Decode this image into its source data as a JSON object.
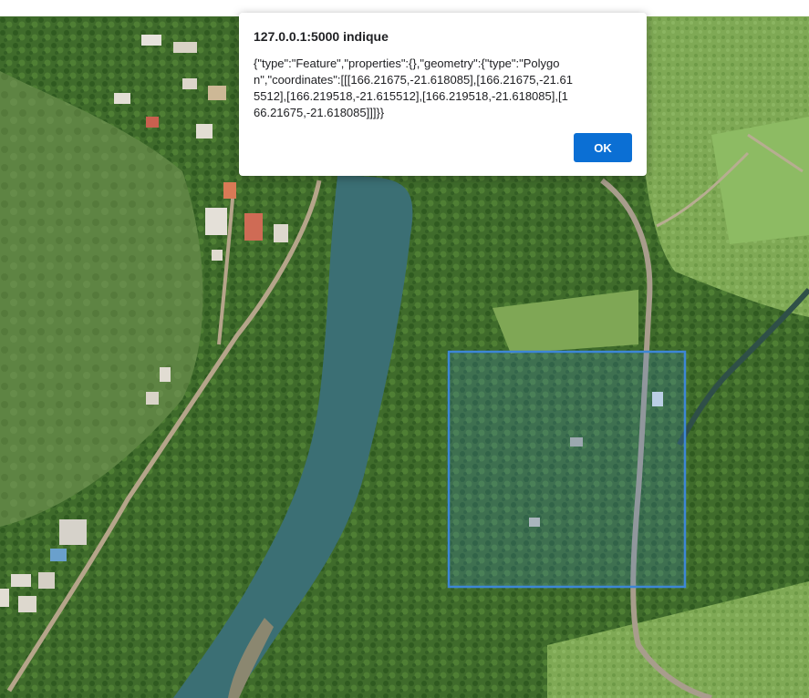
{
  "dialog": {
    "title": "127.0.0.1:5000 indique",
    "message": "{\"type\":\"Feature\",\"properties\":{},\"geometry\":{\"type\":\"Polygon\",\"coordinates\":[[[166.21675,-21.618085],[166.21675,-21.615512],[166.219518,-21.615512],[166.219518,-21.618085],[166.21675,-21.618085]]]}}",
    "ok_label": "OK"
  },
  "map": {
    "type": "satellite imagery",
    "selection_color": "#3d86d6"
  }
}
